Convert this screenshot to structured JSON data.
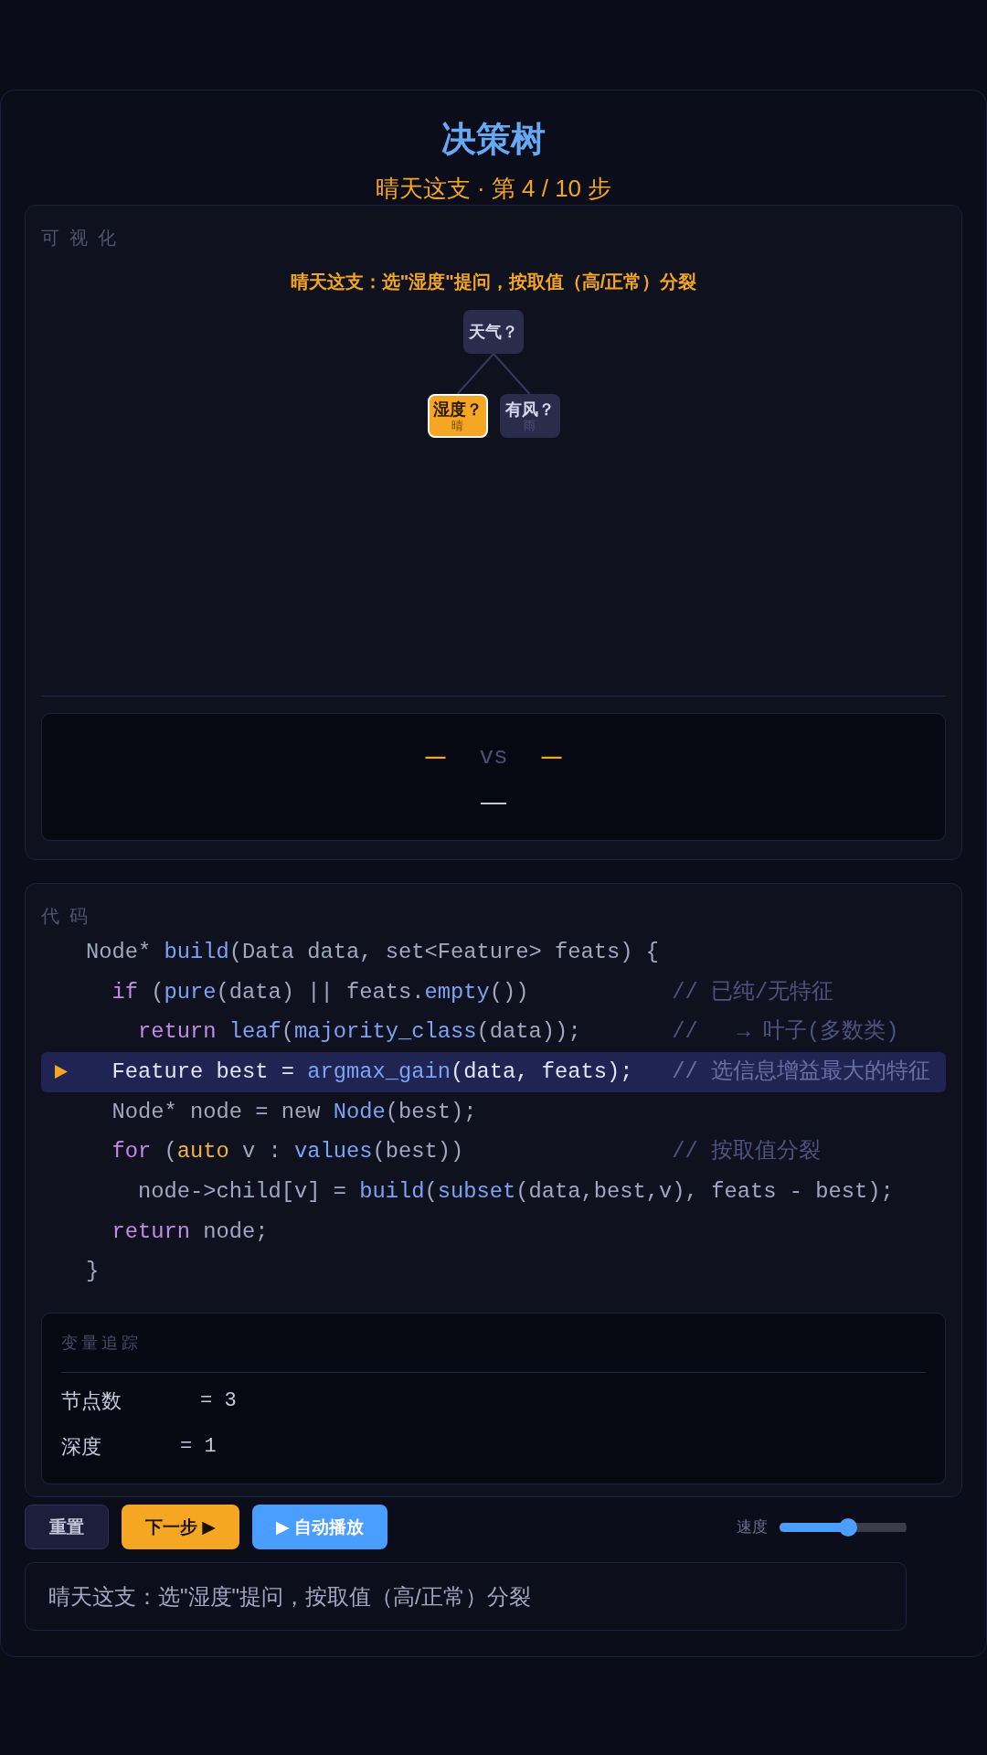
{
  "header": {
    "title": "决策树",
    "subtitle": "晴天这支 · 第 4 / 10 步"
  },
  "visualization": {
    "label": "可视化",
    "caption": "晴天这支：选\"湿度\"提问，按取值（高/正常）分裂",
    "tree": {
      "label": "天气？",
      "highlighted": false,
      "children": [
        {
          "label": "湿度？",
          "branch": "晴",
          "highlighted": true
        },
        {
          "label": "有风？",
          "branch": "雨",
          "highlighted": false
        }
      ]
    },
    "comparison": {
      "left": "—",
      "middle": "vs",
      "right": "—",
      "result": "—"
    }
  },
  "code": {
    "label": "代码",
    "lines": [
      {
        "current": false,
        "tokens": [
          {
            "kind": "plain",
            "text": "Node* "
          },
          {
            "kind": "function",
            "text": "build"
          },
          {
            "kind": "plain",
            "text": "(Data data, set<Feature> feats) {"
          }
        ],
        "children": [
          {
            "current": false,
            "tokens": [
              {
                "kind": "keyword",
                "text": "if"
              },
              {
                "kind": "plain",
                "text": " ("
              },
              {
                "kind": "function",
                "text": "pure"
              },
              {
                "kind": "plain",
                "text": "(data) || feats."
              },
              {
                "kind": "function",
                "text": "empty"
              },
              {
                "kind": "plain",
                "text": "())"
              }
            ],
            "comment": "// 已纯/无特征",
            "children": [
              {
                "current": false,
                "tokens": [
                  {
                    "kind": "keyword",
                    "text": "return "
                  },
                  {
                    "kind": "function",
                    "text": "leaf"
                  },
                  {
                    "kind": "plain",
                    "text": "("
                  },
                  {
                    "kind": "function",
                    "text": "majority_class"
                  },
                  {
                    "kind": "plain",
                    "text": "(data));"
                  }
                ],
                "comment": "//   → 叶子(多数类)"
              }
            ]
          },
          {
            "current": true,
            "tokens": [
              {
                "kind": "plain",
                "text": "Feature best = "
              },
              {
                "kind": "function",
                "text": "argmax_gain"
              },
              {
                "kind": "plain",
                "text": "(data, feats);"
              }
            ],
            "comment": "// 选信息增益最大的特征"
          },
          {
            "current": false,
            "tokens": [
              {
                "kind": "plain",
                "text": "Node* node = new "
              },
              {
                "kind": "function",
                "text": "Node"
              },
              {
                "kind": "plain",
                "text": "(best);"
              }
            ]
          },
          {
            "current": false,
            "tokens": [
              {
                "kind": "keyword",
                "text": "for"
              },
              {
                "kind": "plain",
                "text": " ("
              },
              {
                "kind": "type",
                "text": "auto"
              },
              {
                "kind": "plain",
                "text": " v : "
              },
              {
                "kind": "function",
                "text": "values"
              },
              {
                "kind": "plain",
                "text": "(best))"
              }
            ],
            "comment": "// 按取值分裂",
            "children": [
              {
                "current": false,
                "tokens": [
                  {
                    "kind": "plain",
                    "text": "node->child[v] = "
                  },
                  {
                    "kind": "function",
                    "text": "build"
                  },
                  {
                    "kind": "plain",
                    "text": "("
                  },
                  {
                    "kind": "function",
                    "text": "subset"
                  },
                  {
                    "kind": "plain",
                    "text": "(data,best,v), feats - best);"
                  }
                ]
              }
            ]
          },
          {
            "current": false,
            "tokens": [
              {
                "kind": "keyword",
                "text": "return"
              },
              {
                "kind": "plain",
                "text": " node;"
              }
            ]
          }
        ]
      },
      {
        "current": false,
        "tokens": [
          {
            "kind": "plain",
            "text": "}"
          }
        ]
      }
    ]
  },
  "variables": {
    "title": "变量追踪",
    "items": [
      {
        "name": "节点数",
        "value": "= 3"
      },
      {
        "name": "深度",
        "value": "= 1"
      }
    ]
  },
  "controls": {
    "buttons": [
      {
        "kind": "reset",
        "label": "重置"
      },
      {
        "kind": "next",
        "label": "下一步 ▶"
      },
      {
        "kind": "autoplay",
        "label": "▶ 自动播放"
      }
    ],
    "speed": {
      "label": "速度",
      "level": 0.55
    }
  },
  "status": "晴天这支：选\"湿度\"提问，按取值（高/正常）分裂"
}
